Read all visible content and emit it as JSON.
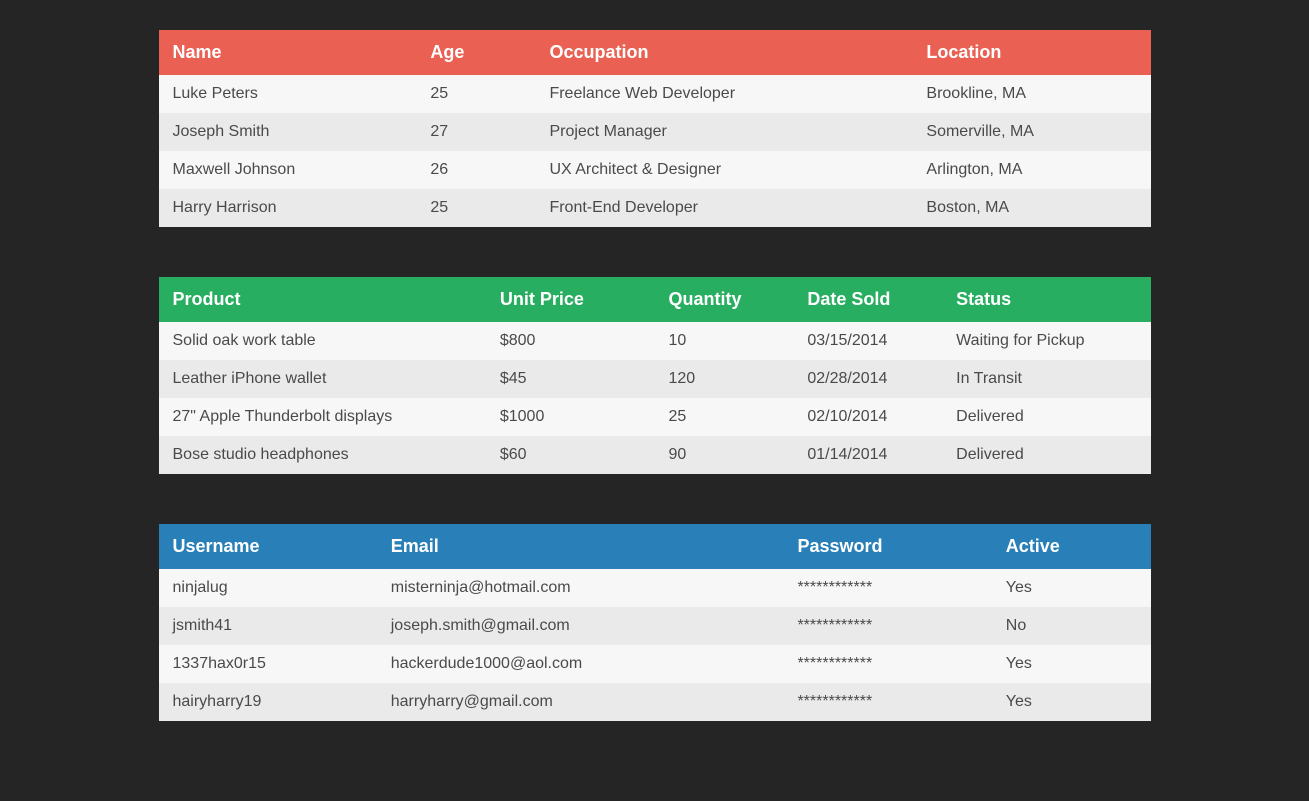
{
  "people": {
    "headers": {
      "name": "Name",
      "age": "Age",
      "occupation": "Occupation",
      "location": "Location"
    },
    "rows": [
      {
        "name": "Luke Peters",
        "age": "25",
        "occupation": "Freelance Web Developer",
        "location": "Brookline, MA"
      },
      {
        "name": "Joseph Smith",
        "age": "27",
        "occupation": "Project Manager",
        "location": "Somerville, MA"
      },
      {
        "name": "Maxwell Johnson",
        "age": "26",
        "occupation": "UX Architect & Designer",
        "location": "Arlington, MA"
      },
      {
        "name": "Harry Harrison",
        "age": "25",
        "occupation": "Front-End Developer",
        "location": "Boston, MA"
      }
    ]
  },
  "sales": {
    "headers": {
      "product": "Product",
      "unit_price": "Unit Price",
      "quantity": "Quantity",
      "date_sold": "Date Sold",
      "status": "Status"
    },
    "rows": [
      {
        "product": "Solid oak work table",
        "unit_price": "$800",
        "quantity": "10",
        "date_sold": "03/15/2014",
        "status": "Waiting for Pickup"
      },
      {
        "product": "Leather iPhone wallet",
        "unit_price": "$45",
        "quantity": "120",
        "date_sold": "02/28/2014",
        "status": "In Transit"
      },
      {
        "product": "27\" Apple Thunderbolt displays",
        "unit_price": "$1000",
        "quantity": "25",
        "date_sold": "02/10/2014",
        "status": "Delivered"
      },
      {
        "product": "Bose studio headphones",
        "unit_price": "$60",
        "quantity": "90",
        "date_sold": "01/14/2014",
        "status": "Delivered"
      }
    ]
  },
  "users": {
    "headers": {
      "username": "Username",
      "email": "Email",
      "password": "Password",
      "active": "Active"
    },
    "rows": [
      {
        "username": "ninjalug",
        "email": "misterninja@hotmail.com",
        "password": "************",
        "active": "Yes"
      },
      {
        "username": "jsmith41",
        "email": "joseph.smith@gmail.com",
        "password": "************",
        "active": "No"
      },
      {
        "username": "1337hax0r15",
        "email": "hackerdude1000@aol.com",
        "password": "************",
        "active": "Yes"
      },
      {
        "username": "hairyharry19",
        "email": "harryharry@gmail.com",
        "password": "************",
        "active": "Yes"
      }
    ]
  }
}
